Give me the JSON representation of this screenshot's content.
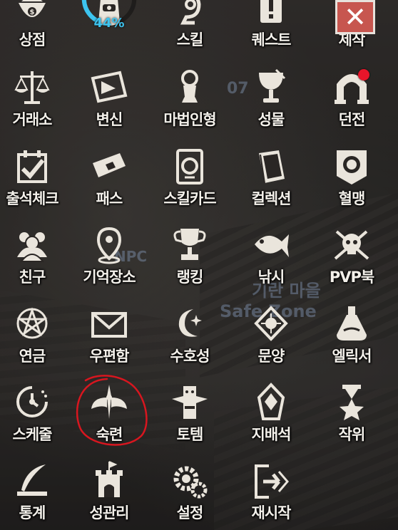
{
  "colors": {
    "label": "#f3f0ea",
    "icon": "#eae5dc",
    "notification_dot": "#e8152a",
    "close_button": "#c7564f",
    "percent_ring": "#3dc4ef",
    "annotation": "#d8161f"
  },
  "background_text": {
    "village": "기란 마을",
    "safe_zone": "Safe Zone",
    "npc": "NPC",
    "counter": "07"
  },
  "bag_progress": {
    "percent_label": "44%",
    "fill_fraction": 0.44
  },
  "close_button": {
    "label": "✕",
    "icon": "close-icon"
  },
  "menu": [
    {
      "label": "상점",
      "icon": "shop-bag-icon"
    },
    {
      "label": "",
      "icon": "inventory-bag-icon"
    },
    {
      "label": "스킬",
      "icon": "skill-icon"
    },
    {
      "label": "퀘스트",
      "icon": "quest-scroll-icon"
    },
    {
      "label": "제작",
      "icon": "anvil-icon"
    },
    {
      "label": "거래소",
      "icon": "scales-icon"
    },
    {
      "label": "변신",
      "icon": "transform-card-icon"
    },
    {
      "label": "마법인형",
      "icon": "magic-doll-icon"
    },
    {
      "label": "성물",
      "icon": "holy-grail-icon"
    },
    {
      "label": "던전",
      "icon": "dungeon-gate-icon",
      "notification": true
    },
    {
      "label": "출석체크",
      "icon": "attendance-check-icon"
    },
    {
      "label": "패스",
      "icon": "pass-ticket-icon"
    },
    {
      "label": "스킬카드",
      "icon": "skill-card-icon"
    },
    {
      "label": "컬렉션",
      "icon": "collection-book-icon"
    },
    {
      "label": "혈맹",
      "icon": "clan-banner-icon"
    },
    {
      "label": "친구",
      "icon": "friends-icon"
    },
    {
      "label": "기억장소",
      "icon": "location-pin-icon"
    },
    {
      "label": "랭킹",
      "icon": "trophy-icon"
    },
    {
      "label": "낚시",
      "icon": "fish-icon"
    },
    {
      "label": "PVP북",
      "icon": "pvp-skull-icon"
    },
    {
      "label": "연금",
      "icon": "alchemy-pentagram-icon"
    },
    {
      "label": "우편함",
      "icon": "mail-envelope-icon"
    },
    {
      "label": "수호성",
      "icon": "guardian-moon-icon"
    },
    {
      "label": "문양",
      "icon": "emblem-icon"
    },
    {
      "label": "엘릭서",
      "icon": "elixir-flask-icon"
    },
    {
      "label": "스케줄",
      "icon": "schedule-clock-icon"
    },
    {
      "label": "숙련",
      "icon": "mastery-wings-icon"
    },
    {
      "label": "토템",
      "icon": "totem-icon"
    },
    {
      "label": "지배석",
      "icon": "dominion-crystal-icon"
    },
    {
      "label": "작위",
      "icon": "rank-medal-icon"
    },
    {
      "label": "통계",
      "icon": "statistics-quill-icon"
    },
    {
      "label": "성관리",
      "icon": "castle-icon"
    },
    {
      "label": "설정",
      "icon": "settings-gears-icon"
    },
    {
      "label": "재시작",
      "icon": "restart-exit-icon"
    }
  ]
}
